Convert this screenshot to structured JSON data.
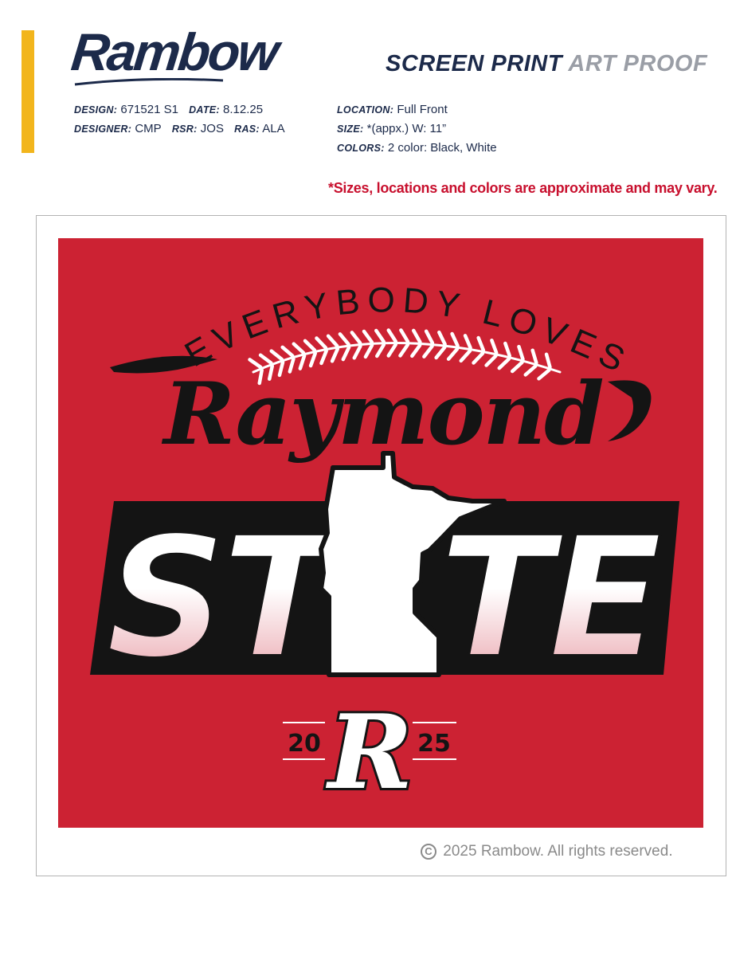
{
  "header": {
    "brand": "Rambow",
    "title_primary": "SCREEN PRINT",
    "title_secondary": "ART PROOF",
    "accent_color": "#f2b51c",
    "brand_color": "#1c2a4a"
  },
  "meta_left": {
    "design_label": "DESIGN:",
    "design_value": "671521 S1",
    "date_label": "DATE:",
    "date_value": "8.12.25",
    "designer_label": "DESIGNER:",
    "designer_value": "CMP",
    "rsr_label": "RSR:",
    "rsr_value": "JOS",
    "ras_label": "RAS:",
    "ras_value": "ALA"
  },
  "meta_right": {
    "location_label": "LOCATION:",
    "location_value": "Full Front",
    "size_label": "SIZE:",
    "size_value": "*(appx.) W: 11”",
    "colors_label": "COLORS:",
    "colors_value": "2 color: Black, White"
  },
  "disclaimer": "*Sizes, locations  and colors are approximate and may vary.",
  "artwork": {
    "background_color": "#cc2233",
    "arc_text": "EVERYBODY LOVES",
    "script_text": "Raymond",
    "block_left": "ST",
    "block_right": "TE",
    "monogram": "R",
    "year_left": "20",
    "year_right": "25"
  },
  "footer": {
    "copyright_symbol": "C",
    "copyright_text": "2025 Rambow. All rights reserved."
  }
}
